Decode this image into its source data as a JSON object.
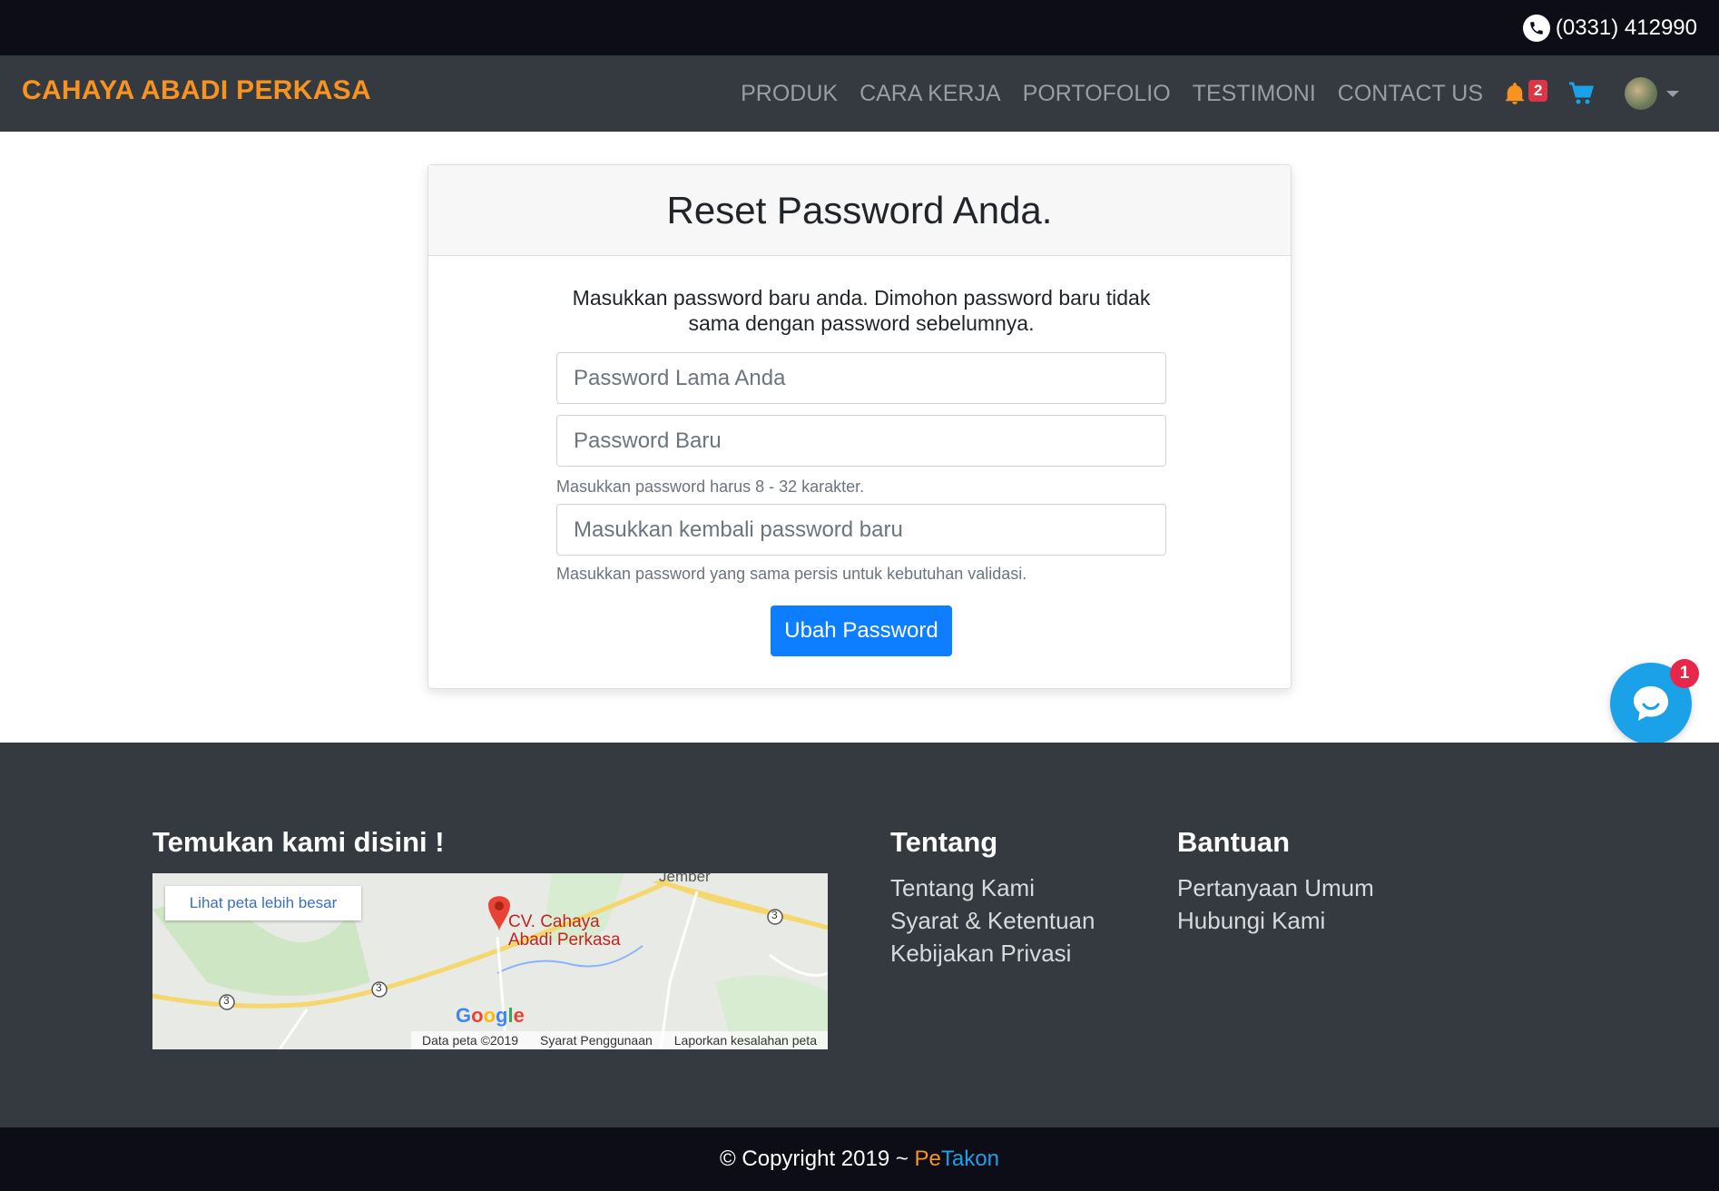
{
  "topbar": {
    "phone": "(0331) 412990"
  },
  "navbar": {
    "brand": "CAHAYA ABADI PERKASA",
    "links": [
      "PRODUK",
      "CARA KERJA",
      "PORTOFOLIO",
      "TESTIMONI",
      "CONTACT US"
    ],
    "notification_count": "2",
    "icons": {
      "notification": "bell-icon",
      "cart": "cart-icon",
      "avatar": "user-avatar"
    },
    "colors": {
      "brand": "#f7931e",
      "bell": "#f7931e",
      "cart": "#1aa1e8"
    }
  },
  "card": {
    "title": "Reset Password Anda.",
    "description": "Masukkan password baru anda. Dimohon password baru tidak sama dengan password sebelumnya.",
    "old_password_placeholder": "Password Lama Anda",
    "new_password_placeholder": "Password Baru",
    "new_password_hint": "Masukkan password harus 8 - 32 karakter.",
    "confirm_password_placeholder": "Masukkan kembali password baru",
    "confirm_password_hint": "Masukkan password yang sama persis untuk kebutuhan validasi.",
    "submit_label": "Ubah Password"
  },
  "chat": {
    "badge": "1",
    "color": "#1aa1e8"
  },
  "footer": {
    "location_title": "Temukan kami disini !",
    "map": {
      "larger_map_link": "Lihat peta lebih besar",
      "place_label": "CV. Cahaya Abadi Perkasa",
      "city_label": "Jember",
      "road_number": "3",
      "data_credit": "Data peta ©2019",
      "terms": "Syarat Penggunaan",
      "report": "Laporkan kesalahan peta"
    },
    "about": {
      "title": "Tentang",
      "items": [
        "Tentang Kami",
        "Syarat & Ketentuan",
        "Kebijakan Privasi"
      ]
    },
    "help": {
      "title": "Bantuan",
      "items": [
        "Pertanyaan Umum",
        "Hubungi Kami"
      ]
    },
    "copyright_prefix": "© Copyright 2019 ~ ",
    "brand_pe": "Pe",
    "brand_takon": "Takon"
  }
}
